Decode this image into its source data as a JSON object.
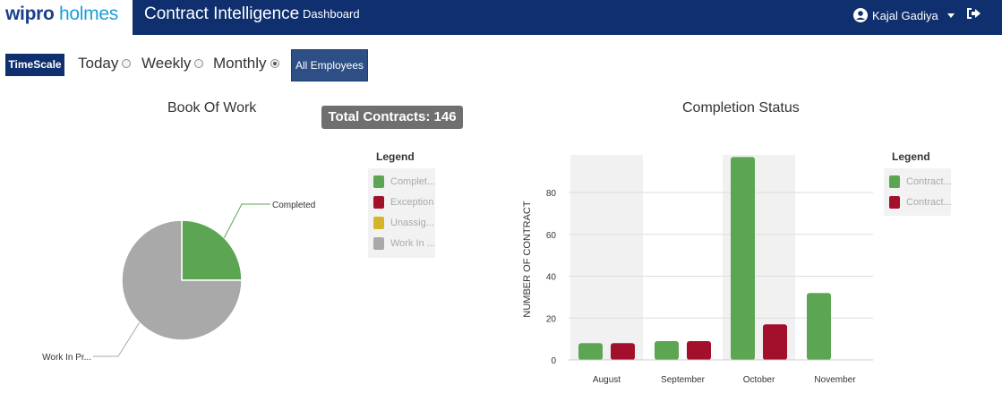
{
  "header": {
    "logo_part1": "wipro",
    "logo_part2": "holmes",
    "app_title": "Contract Intelligence",
    "nav_dashboard": "Dashboard",
    "user_name": "Kajal Gadiya",
    "icons": {
      "user": "user-circle-icon",
      "caret": "caret-down-icon",
      "logout": "sign-out-icon"
    },
    "colors": {
      "bar": "#0f2f6e"
    }
  },
  "toolbar": {
    "timescale_label": "TimeScale",
    "options": [
      {
        "label": "Today",
        "selected": false
      },
      {
        "label": "Weekly",
        "selected": false
      },
      {
        "label": "Monthly",
        "selected": true
      }
    ],
    "all_employees_label": "All Employees"
  },
  "book_of_work": {
    "title": "Book Of Work",
    "total_badge": "Total Contracts: 146",
    "legend_title": "Legend",
    "legend_items": [
      {
        "label": "Complet...",
        "color": "#5ba553"
      },
      {
        "label": "Exception",
        "color": "#a3102c"
      },
      {
        "label": "Unassig...",
        "color": "#d4b52a"
      },
      {
        "label": "Work In ...",
        "color": "#a9a9a9"
      }
    ]
  },
  "completion_status": {
    "title": "Completion Status",
    "legend_title": "Legend",
    "legend_items": [
      {
        "label": "Contract...",
        "color": "#5ba553"
      },
      {
        "label": "Contract...",
        "color": "#a3102c"
      }
    ]
  },
  "chart_data": [
    {
      "type": "pie",
      "title": "Book Of Work",
      "slices": [
        {
          "label": "Completed",
          "value": 25,
          "color": "#5ba553"
        },
        {
          "label": "Work In Pr...",
          "value": 75,
          "color": "#a9a9a9"
        }
      ]
    },
    {
      "type": "bar",
      "title": "Completion Status",
      "categories": [
        "August",
        "September",
        "October",
        "November"
      ],
      "ylabel": "NUMBER OF CONTRACT",
      "ylim": [
        0,
        98
      ],
      "yticks": [
        0,
        20,
        40,
        60,
        80
      ],
      "grid": true,
      "highlighted_categories": [
        "August",
        "October"
      ],
      "series": [
        {
          "color": "#5ba553",
          "values": [
            8,
            9,
            97,
            32
          ]
        },
        {
          "color": "#a3102c",
          "values": [
            8,
            9,
            17,
            0
          ]
        }
      ]
    }
  ]
}
